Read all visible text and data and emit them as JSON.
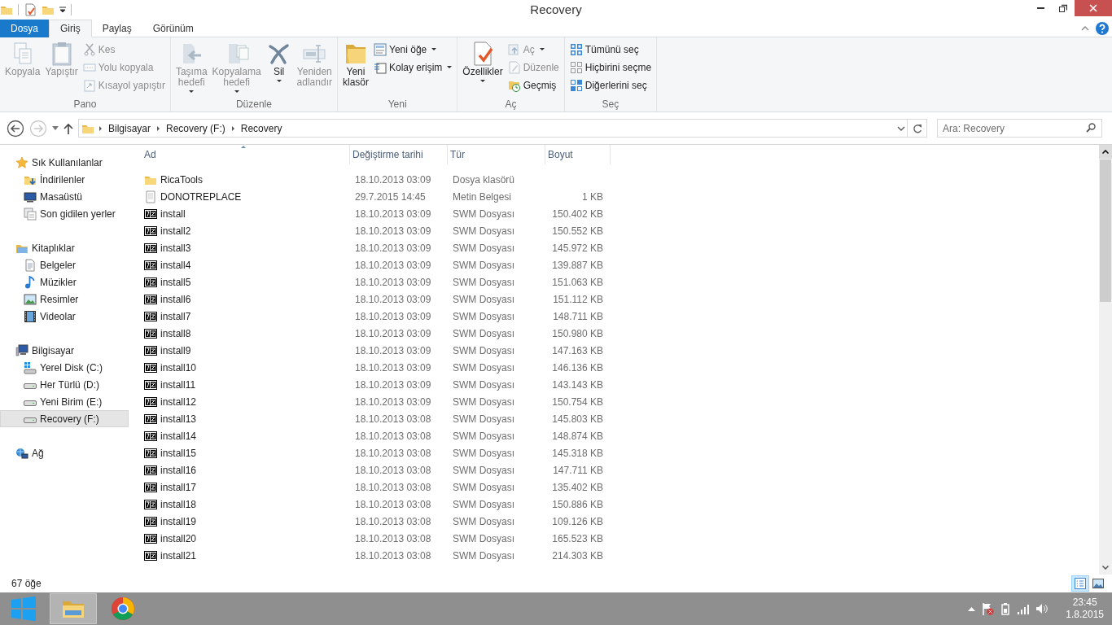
{
  "window": {
    "title": "Recovery"
  },
  "ribbon_tabs": [
    {
      "label": "Dosya",
      "kind": "file",
      "selected": false
    },
    {
      "label": "Giriş",
      "kind": "tab",
      "selected": true
    },
    {
      "label": "Paylaş",
      "kind": "tab",
      "selected": false
    },
    {
      "label": "Görünüm",
      "kind": "tab",
      "selected": false
    }
  ],
  "ribbon_groups": [
    {
      "label": "Pano",
      "items": [
        {
          "label": "Kopyala",
          "kind": "large",
          "disabled": true,
          "dropdown": false
        },
        {
          "label": "Yapıştır",
          "kind": "large",
          "disabled": true,
          "dropdown": false
        },
        {
          "label": "Kes",
          "kind": "small",
          "disabled": true,
          "dropdown": false
        },
        {
          "label": "Yolu kopyala",
          "kind": "small",
          "disabled": true,
          "dropdown": false
        },
        {
          "label": "Kısayol yapıştır",
          "kind": "small",
          "disabled": true,
          "dropdown": false
        }
      ]
    },
    {
      "label": "Düzenle",
      "items": [
        {
          "label": "Taşıma hedefi",
          "kind": "large",
          "disabled": true,
          "dropdown": true
        },
        {
          "label": "Kopyalama hedefi",
          "kind": "large",
          "disabled": true,
          "dropdown": true
        },
        {
          "label": "Sil",
          "kind": "large",
          "disabled": false,
          "dropdown": true
        },
        {
          "label": "Yeniden adlandır",
          "kind": "large",
          "disabled": true,
          "dropdown": false
        }
      ]
    },
    {
      "label": "Yeni",
      "items": [
        {
          "label": "Yeni klasör",
          "kind": "large",
          "disabled": false,
          "dropdown": false
        },
        {
          "label": "Yeni öğe",
          "kind": "small",
          "disabled": false,
          "dropdown": true
        },
        {
          "label": "Kolay erişim",
          "kind": "small",
          "disabled": false,
          "dropdown": true
        }
      ]
    },
    {
      "label": "Aç",
      "items": [
        {
          "label": "Özellikler",
          "kind": "large",
          "disabled": false,
          "dropdown": true
        },
        {
          "label": "Aç",
          "kind": "small",
          "disabled": true,
          "dropdown": true
        },
        {
          "label": "Düzenle",
          "kind": "small",
          "disabled": true,
          "dropdown": false
        },
        {
          "label": "Geçmiş",
          "kind": "small",
          "disabled": false,
          "dropdown": false
        }
      ]
    },
    {
      "label": "Seç",
      "items": [
        {
          "label": "Tümünü seç",
          "kind": "small",
          "disabled": false,
          "dropdown": false
        },
        {
          "label": "Hiçbirini seçme",
          "kind": "small",
          "disabled": false,
          "dropdown": false
        },
        {
          "label": "Diğerlerini seç",
          "kind": "small",
          "disabled": false,
          "dropdown": false
        }
      ]
    }
  ],
  "address_bar": {
    "breadcrumbs": [
      "Bilgisayar",
      "Recovery (F:)",
      "Recovery"
    ],
    "forward_disabled": true
  },
  "search": {
    "placeholder": "Ara: Recovery"
  },
  "navigation": [
    {
      "label": "Sık Kullanılanlar",
      "selected": false,
      "children": [
        {
          "label": "İndirilenler",
          "selected": false
        },
        {
          "label": "Masaüstü",
          "selected": false
        },
        {
          "label": "Son gidilen yerler",
          "selected": false
        }
      ]
    },
    {
      "label": "Kitaplıklar",
      "selected": false,
      "children": [
        {
          "label": "Belgeler",
          "selected": false
        },
        {
          "label": "Müzikler",
          "selected": false
        },
        {
          "label": "Resimler",
          "selected": false
        },
        {
          "label": "Videolar",
          "selected": false
        }
      ]
    },
    {
      "label": "Bilgisayar",
      "selected": false,
      "children": [
        {
          "label": "Yerel Disk (C:)",
          "selected": false
        },
        {
          "label": "Her Türlü (D:)",
          "selected": false
        },
        {
          "label": "Yeni Birim (E:)",
          "selected": false
        },
        {
          "label": "Recovery (F:)",
          "selected": true
        }
      ]
    },
    {
      "label": "Ağ",
      "selected": false
    }
  ],
  "files": {
    "columns": [
      {
        "label": "Ad",
        "sorted": true
      },
      {
        "label": "Değiştirme tarihi",
        "sorted": false
      },
      {
        "label": "Tür",
        "sorted": false
      },
      {
        "label": "Boyut",
        "sorted": false
      }
    ],
    "rows": [
      {
        "kind": "folder",
        "name": "RicaTools",
        "date": "18.10.2013 03:09",
        "type": "Dosya klasörü",
        "size": ""
      },
      {
        "kind": "text",
        "name": "DONOTREPLACE",
        "date": "29.7.2015 14:45",
        "type": "Metin Belgesi",
        "size": "1 KB"
      },
      {
        "kind": "archive",
        "name": "install",
        "date": "18.10.2013 03:09",
        "type": "SWM Dosyası",
        "size": "150.402 KB"
      },
      {
        "kind": "archive",
        "name": "install2",
        "date": "18.10.2013 03:09",
        "type": "SWM Dosyası",
        "size": "150.552 KB"
      },
      {
        "kind": "archive",
        "name": "install3",
        "date": "18.10.2013 03:09",
        "type": "SWM Dosyası",
        "size": "145.972 KB"
      },
      {
        "kind": "archive",
        "name": "install4",
        "date": "18.10.2013 03:09",
        "type": "SWM Dosyası",
        "size": "139.887 KB"
      },
      {
        "kind": "archive",
        "name": "install5",
        "date": "18.10.2013 03:09",
        "type": "SWM Dosyası",
        "size": "151.063 KB"
      },
      {
        "kind": "archive",
        "name": "install6",
        "date": "18.10.2013 03:09",
        "type": "SWM Dosyası",
        "size": "151.112 KB"
      },
      {
        "kind": "archive",
        "name": "install7",
        "date": "18.10.2013 03:09",
        "type": "SWM Dosyası",
        "size": "148.711 KB"
      },
      {
        "kind": "archive",
        "name": "install8",
        "date": "18.10.2013 03:09",
        "type": "SWM Dosyası",
        "size": "150.980 KB"
      },
      {
        "kind": "archive",
        "name": "install9",
        "date": "18.10.2013 03:09",
        "type": "SWM Dosyası",
        "size": "147.163 KB"
      },
      {
        "kind": "archive",
        "name": "install10",
        "date": "18.10.2013 03:09",
        "type": "SWM Dosyası",
        "size": "146.136 KB"
      },
      {
        "kind": "archive",
        "name": "install11",
        "date": "18.10.2013 03:09",
        "type": "SWM Dosyası",
        "size": "143.143 KB"
      },
      {
        "kind": "archive",
        "name": "install12",
        "date": "18.10.2013 03:09",
        "type": "SWM Dosyası",
        "size": "150.754 KB"
      },
      {
        "kind": "archive",
        "name": "install13",
        "date": "18.10.2013 03:08",
        "type": "SWM Dosyası",
        "size": "145.803 KB"
      },
      {
        "kind": "archive",
        "name": "install14",
        "date": "18.10.2013 03:08",
        "type": "SWM Dosyası",
        "size": "148.874 KB"
      },
      {
        "kind": "archive",
        "name": "install15",
        "date": "18.10.2013 03:08",
        "type": "SWM Dosyası",
        "size": "145.318 KB"
      },
      {
        "kind": "archive",
        "name": "install16",
        "date": "18.10.2013 03:08",
        "type": "SWM Dosyası",
        "size": "147.711 KB"
      },
      {
        "kind": "archive",
        "name": "install17",
        "date": "18.10.2013 03:08",
        "type": "SWM Dosyası",
        "size": "135.402 KB"
      },
      {
        "kind": "archive",
        "name": "install18",
        "date": "18.10.2013 03:08",
        "type": "SWM Dosyası",
        "size": "150.886 KB"
      },
      {
        "kind": "archive",
        "name": "install19",
        "date": "18.10.2013 03:08",
        "type": "SWM Dosyası",
        "size": "109.126 KB"
      },
      {
        "kind": "archive",
        "name": "install20",
        "date": "18.10.2013 03:08",
        "type": "SWM Dosyası",
        "size": "165.523 KB"
      },
      {
        "kind": "archive",
        "name": "install21",
        "date": "18.10.2013 03:08",
        "type": "SWM Dosyası",
        "size": "214.303 KB"
      }
    ]
  },
  "status_bar": {
    "item_count": "67 öğe"
  },
  "view_buttons": [
    {
      "kind": "details",
      "selected": true
    },
    {
      "kind": "large-icons",
      "selected": false
    }
  ],
  "taskbar": {
    "apps": [
      {
        "kind": "explorer",
        "selected": true
      },
      {
        "kind": "browser",
        "selected": false
      }
    ],
    "clock": {
      "time": "23:45",
      "date": "1.8.2015"
    }
  }
}
